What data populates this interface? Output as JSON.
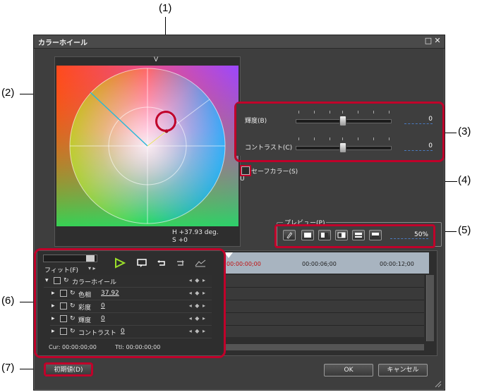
{
  "callouts": {
    "c1": "(1)",
    "c2": "(2)",
    "c3": "(3)",
    "c4": "(4)",
    "c5": "(5)",
    "c6": "(6)",
    "c7": "(7)"
  },
  "window": {
    "title": "カラーホイール",
    "maximize_glyph": "□",
    "close_glyph": "✕"
  },
  "wheel": {
    "v_label": "V",
    "u_label": "U",
    "h_readout": "H  +37.93  deg.",
    "s_readout": "S   +0"
  },
  "sliders": [
    {
      "label": "輝度(B)",
      "value": "0",
      "position": 0.5
    },
    {
      "label": "コントラスト(C)",
      "value": "0",
      "position": 0.5
    }
  ],
  "safe_color": {
    "label": "セーフカラー(S)",
    "checked": false
  },
  "preview": {
    "legend": "プレビュー(P)",
    "percent": "50%"
  },
  "timeline": {
    "fit_label": "フィット(F)",
    "ruler": [
      "00:00:00;00",
      "00:00:06;00",
      "00:00:12;00"
    ],
    "rows": [
      {
        "label": "カラーホイール",
        "value": ""
      },
      {
        "label": "色相",
        "value": "37.92"
      },
      {
        "label": "彩度",
        "value": "0"
      },
      {
        "label": "輝度",
        "value": "0"
      },
      {
        "label": "コントラスト",
        "value": "0"
      }
    ],
    "cur": "Cur: 00:00:00;00",
    "ttl": "Ttl: 00:00:00;00"
  },
  "buttons": {
    "reset": "初期値(D)",
    "ok": "OK",
    "cancel": "キャンセル"
  },
  "colors": {
    "accent": "#4a7ac0",
    "callout": "#c0002a",
    "play": "#9be02a"
  }
}
